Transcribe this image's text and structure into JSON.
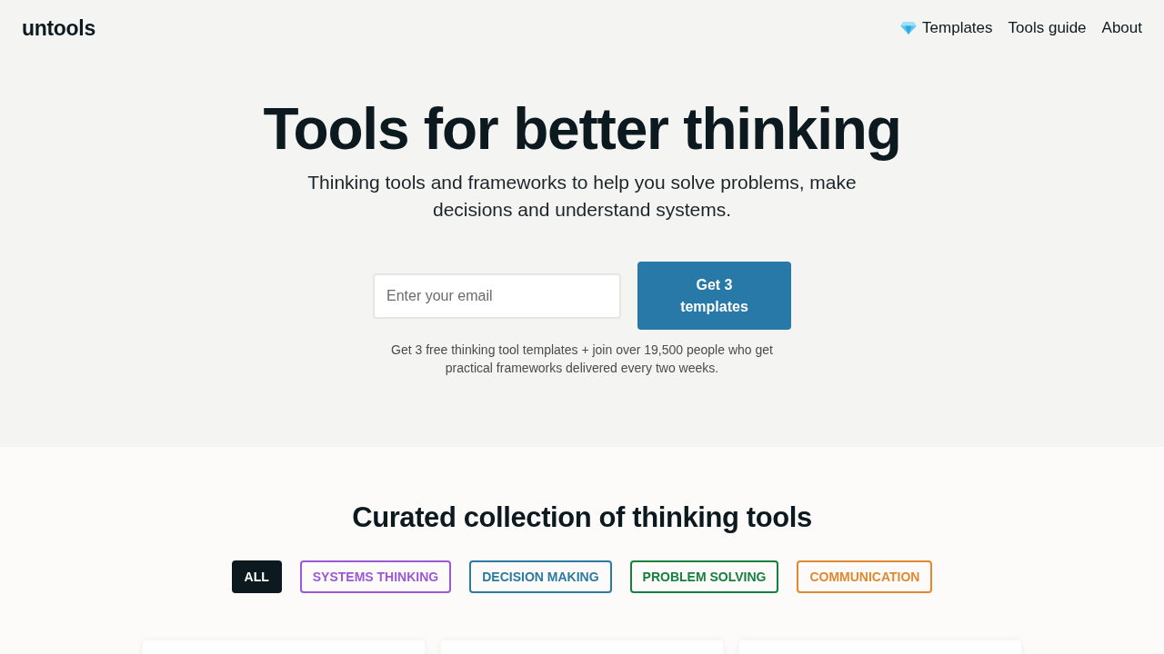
{
  "header": {
    "logo": "untools",
    "nav": [
      {
        "label": "Templates",
        "kind": "gem"
      },
      {
        "label": "Tools guide",
        "kind": "plain"
      },
      {
        "label": "About",
        "kind": "plain"
      }
    ]
  },
  "hero": {
    "title": "Tools for better thinking",
    "subtitle": "Thinking tools and frameworks to help you solve problems, make decisions and understand systems.",
    "email": {
      "placeholder": "Enter your email"
    },
    "button": "Get 3 templates",
    "note": "Get 3 free thinking tool templates + join over 19,500 people who get practical frameworks delivered every two weeks."
  },
  "collection": {
    "heading": "Curated collection of thinking tools",
    "filters": [
      {
        "label": "ALL",
        "selected": true,
        "color": "#0c1a1f"
      },
      {
        "label": "SYSTEMS THINKING",
        "selected": false,
        "color": "#9b59d6"
      },
      {
        "label": "DECISION MAKING",
        "selected": false,
        "color": "#2a7aa2"
      },
      {
        "label": "PROBLEM SOLVING",
        "selected": false,
        "color": "#16803f"
      },
      {
        "label": "COMMUNICATION",
        "selected": false,
        "color": "#e0892f"
      }
    ],
    "cards": [
      {
        "kind": "tool"
      },
      {
        "kind": "tool"
      },
      {
        "kind": "tool"
      }
    ]
  }
}
